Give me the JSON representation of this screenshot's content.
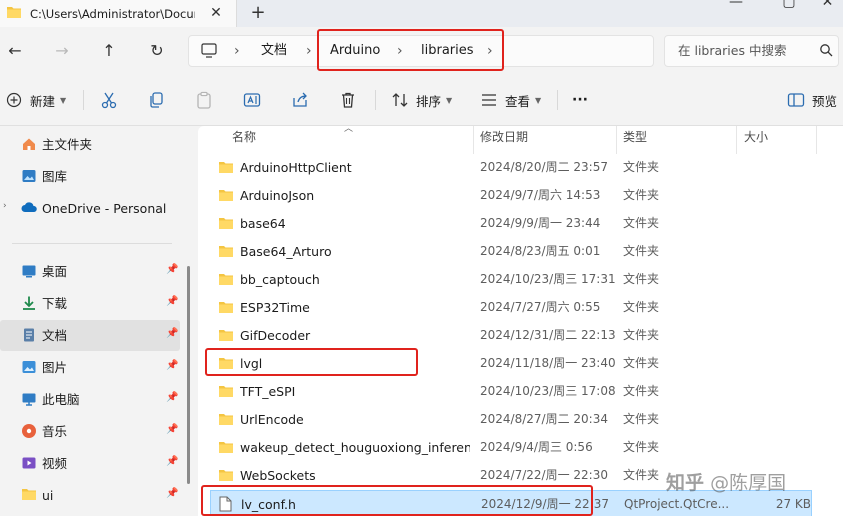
{
  "window": {
    "tab_title": "C:\\Users\\Administrator\\Docun",
    "tab_close": "✕",
    "new_tab": "+",
    "minimize": "—",
    "maximize": "▢",
    "close": "✕"
  },
  "address": {
    "breadcrumbs": [
      "文档",
      "Arduino",
      "libraries"
    ],
    "separator": "›",
    "search_placeholder": "在 libraries 中搜索"
  },
  "toolbar": {
    "new_label": "新建",
    "sort_label": "排序",
    "view_label": "查看",
    "more_label": "···",
    "preview_label": "预览"
  },
  "sidebar": {
    "items": [
      {
        "label": "主文件夹",
        "icon": "home-icon"
      },
      {
        "label": "图库",
        "icon": "gallery-icon"
      },
      {
        "label": "OneDrive - Personal",
        "icon": "cloud-icon"
      },
      {
        "label": "桌面",
        "icon": "desktop-icon"
      },
      {
        "label": "下载",
        "icon": "download-icon"
      },
      {
        "label": "文档",
        "icon": "document-icon"
      },
      {
        "label": "图片",
        "icon": "pictures-icon"
      },
      {
        "label": "此电脑",
        "icon": "computer-icon"
      },
      {
        "label": "音乐",
        "icon": "music-icon"
      },
      {
        "label": "视频",
        "icon": "video-icon"
      },
      {
        "label": "ui",
        "icon": "folder-icon"
      }
    ]
  },
  "columns": {
    "name": "名称",
    "date": "修改日期",
    "type": "类型",
    "size": "大小"
  },
  "files": [
    {
      "name": "ArduinoHttpClient",
      "date": "2024/8/20/周二 23:57",
      "type": "文件夹",
      "size": ""
    },
    {
      "name": "ArduinoJson",
      "date": "2024/9/7/周六 14:53",
      "type": "文件夹",
      "size": ""
    },
    {
      "name": "base64",
      "date": "2024/9/9/周一 23:44",
      "type": "文件夹",
      "size": ""
    },
    {
      "name": "Base64_Arturo",
      "date": "2024/8/23/周五 0:01",
      "type": "文件夹",
      "size": ""
    },
    {
      "name": "bb_captouch",
      "date": "2024/10/23/周三 17:31",
      "type": "文件夹",
      "size": ""
    },
    {
      "name": "ESP32Time",
      "date": "2024/7/27/周六 0:55",
      "type": "文件夹",
      "size": ""
    },
    {
      "name": "GifDecoder",
      "date": "2024/12/31/周二 22:13",
      "type": "文件夹",
      "size": ""
    },
    {
      "name": "lvgl",
      "date": "2024/11/18/周一 23:40",
      "type": "文件夹",
      "size": ""
    },
    {
      "name": "TFT_eSPI",
      "date": "2024/10/23/周三 17:08",
      "type": "文件夹",
      "size": ""
    },
    {
      "name": "UrlEncode",
      "date": "2024/8/27/周二 20:34",
      "type": "文件夹",
      "size": ""
    },
    {
      "name": "wakeup_detect_houguoxiong_inferen...",
      "date": "2024/9/4/周三 0:56",
      "type": "文件夹",
      "size": ""
    },
    {
      "name": "WebSockets",
      "date": "2024/7/22/周一 22:30",
      "type": "文件夹",
      "size": ""
    },
    {
      "name": "lv_conf.h",
      "date": "2024/12/9/周一 22:37",
      "type": "QtProject.QtCre...",
      "size": "27 KB"
    }
  ],
  "watermark": {
    "logo": "知乎",
    "author": "@陈厚国"
  },
  "colors": {
    "highlight": "#e0231d",
    "selected_row": "#cce8ff",
    "folder": "#f4c542"
  }
}
